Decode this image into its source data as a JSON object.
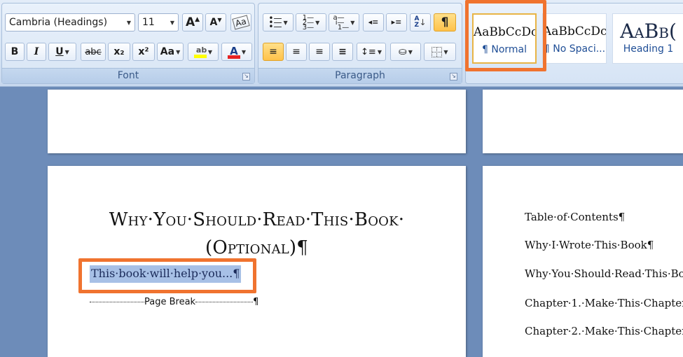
{
  "ribbon": {
    "font_group": {
      "label": "Font",
      "font_name": "Cambria (Headings)",
      "font_size": "11",
      "grow_label": "A",
      "shrink_label": "A",
      "bold": "B",
      "italic": "I",
      "underline": "U",
      "strikethrough": "abc",
      "subscript": "x₂",
      "superscript": "x²",
      "change_case": "Aa",
      "font_color_label": "A",
      "highlight_color": "#ffff00",
      "font_color": "#e52222"
    },
    "paragraph_group": {
      "label": "Paragraph",
      "show_marks": "¶"
    },
    "styles": [
      {
        "preview": "AaBbCcDc",
        "name": "¶ Normal"
      },
      {
        "preview": "AaBbCcDc",
        "name": "¶ No Spaci..."
      },
      {
        "preview": "AaBb(",
        "name": "Heading 1"
      }
    ]
  },
  "document": {
    "left_page": {
      "title_line1": "Why·You·Should·Read·This·Book·",
      "title_line2": "(Optional)¶",
      "selected_paragraph": "This·book·will·help·you...¶",
      "page_break_label": "Page Break",
      "page_break_mark": "¶"
    },
    "right_page": {
      "toc": [
        "Table·of·Contents¶",
        "Why·I·Wrote·This·Book¶",
        "Why·You·Should·Read·This·Bo",
        "Chapter·1.·Make·This·Chapter",
        "Chapter·2.·Make·This·Chapter"
      ]
    }
  },
  "colors": {
    "callout": "#f0732f",
    "selection": "#a7c0e6",
    "workspace": "#6d8cb9"
  }
}
